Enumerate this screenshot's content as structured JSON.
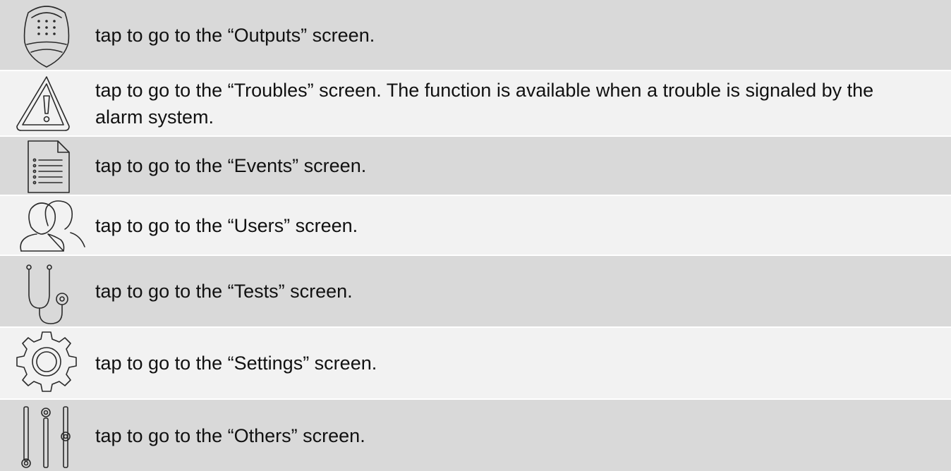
{
  "rows": [
    {
      "icon": "keypad-icon",
      "text": "tap to go to the “Outputs” screen."
    },
    {
      "icon": "warning-icon",
      "text": "tap to go to the “Troubles” screen. The function is available when a trouble is signaled by the alarm system."
    },
    {
      "icon": "document-list-icon",
      "text": "tap to go to the “Events” screen."
    },
    {
      "icon": "users-icon",
      "text": "tap to go to the “Users” screen."
    },
    {
      "icon": "stethoscope-icon",
      "text": "tap to go to the “Tests” screen."
    },
    {
      "icon": "gear-icon",
      "text": "tap to go to the “Settings” screen."
    },
    {
      "icon": "sliders-icon",
      "text": "tap to go to the “Others” screen."
    }
  ]
}
